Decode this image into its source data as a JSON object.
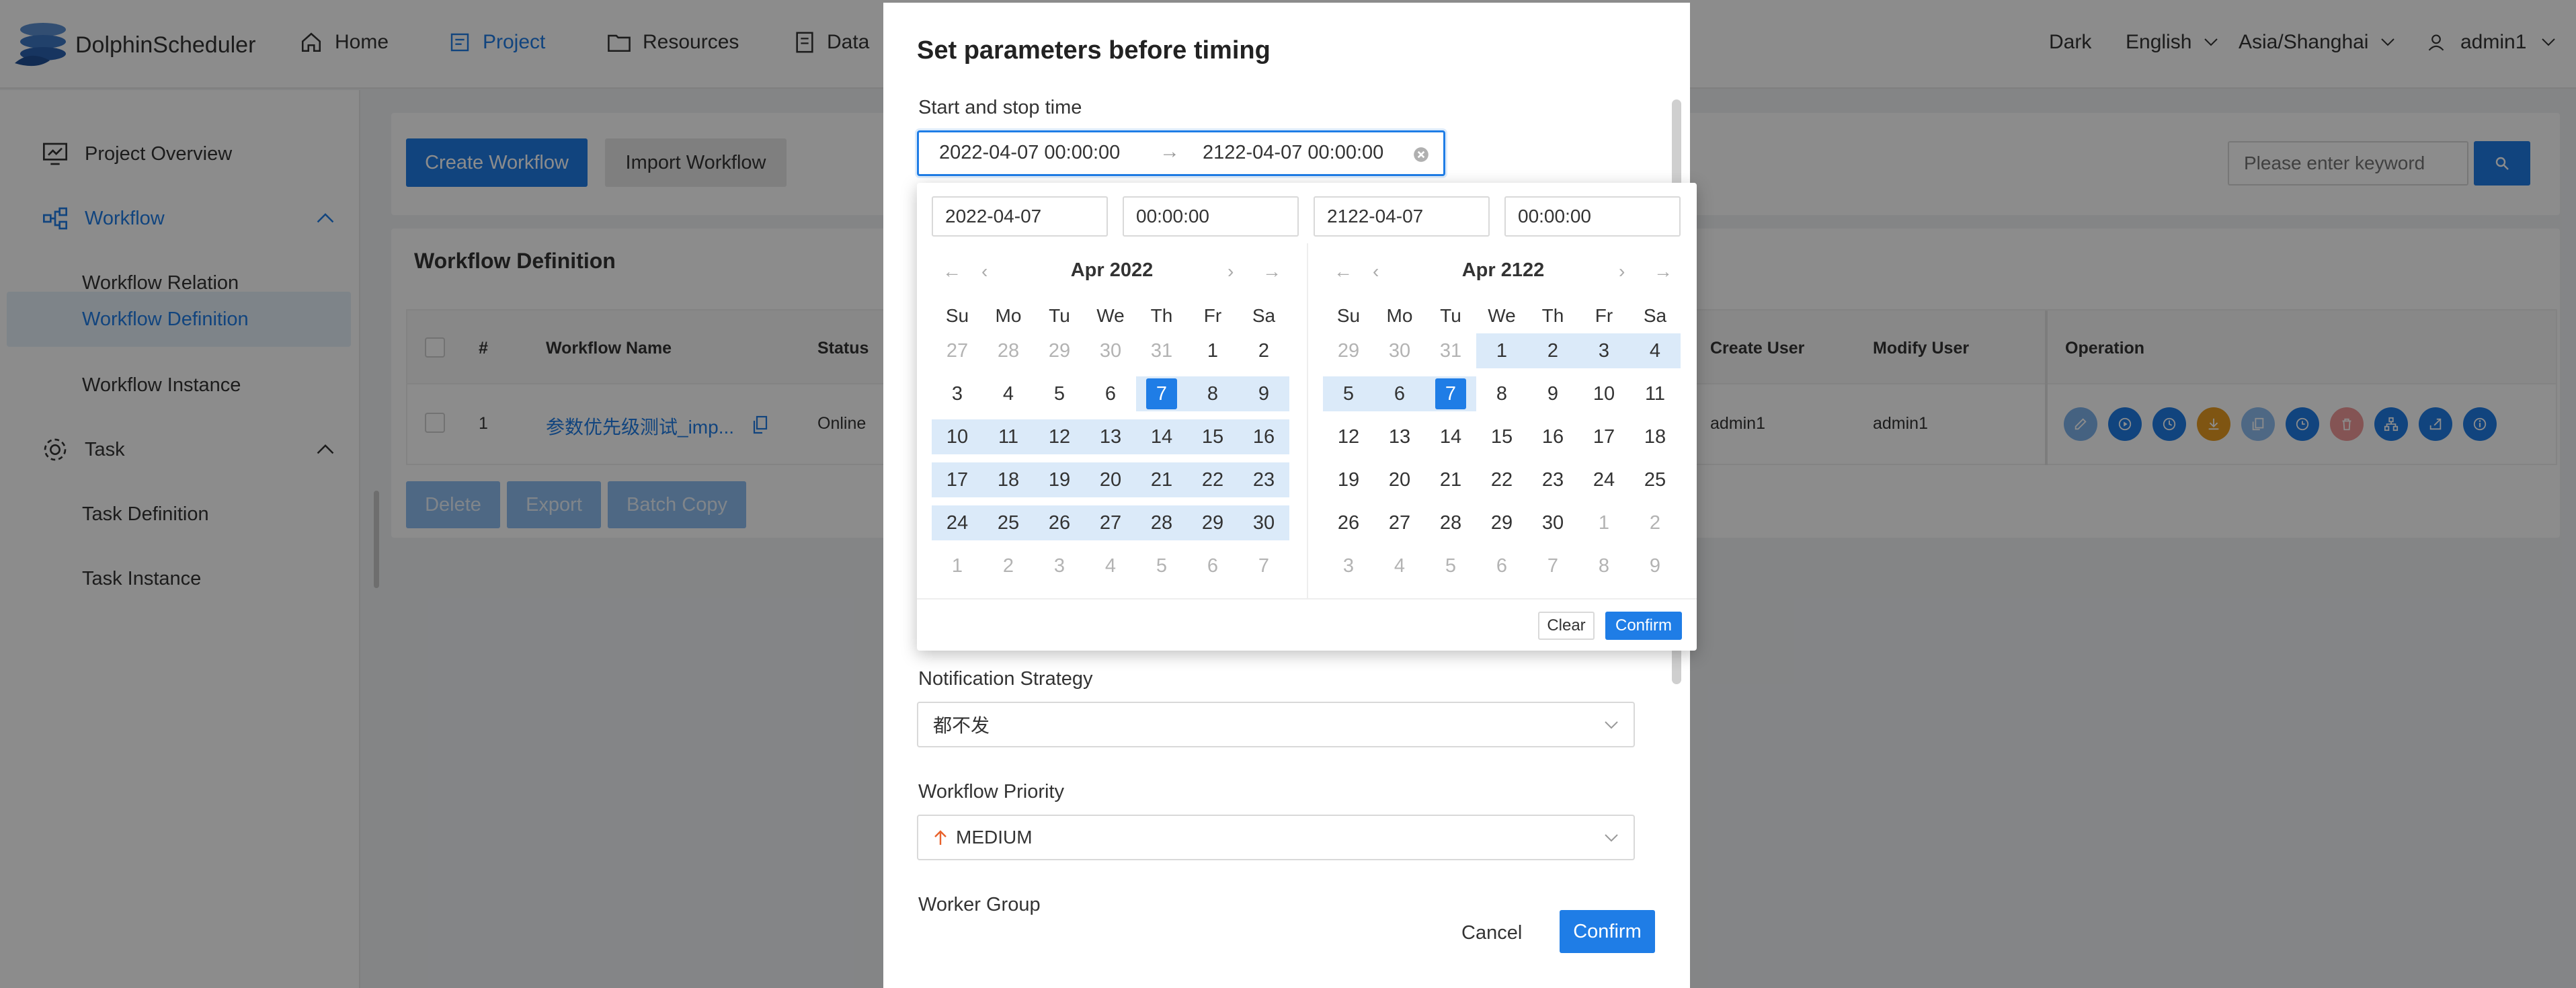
{
  "app": {
    "brand": "DolphinScheduler",
    "nav": [
      {
        "label": "Home",
        "icon": "home-icon"
      },
      {
        "label": "Project",
        "icon": "project-icon"
      },
      {
        "label": "Resources",
        "icon": "folder-icon"
      },
      {
        "label": "Data",
        "icon": "document-icon"
      }
    ],
    "theme": "Dark",
    "language": "English",
    "timezone": "Asia/Shanghai",
    "user": "admin1"
  },
  "sidebar": {
    "project_overview": "Project Overview",
    "workflow": "Workflow",
    "workflow_relation": "Workflow Relation",
    "workflow_definition": "Workflow Definition",
    "workflow_instance": "Workflow Instance",
    "task": "Task",
    "task_definition": "Task Definition",
    "task_instance": "Task Instance"
  },
  "toolbar": {
    "create_workflow": "Create Workflow",
    "import_workflow": "Import Workflow",
    "search_placeholder": "Please enter keyword"
  },
  "table": {
    "title": "Workflow Definition",
    "headers": {
      "index": "#",
      "name": "Workflow Name",
      "status": "Status",
      "create_user": "Create User",
      "modify_user": "Modify User",
      "operation": "Operation"
    },
    "rows": [
      {
        "index": "1",
        "name": "参数优先级测试_imp...",
        "status": "Online",
        "create_user": "admin1",
        "modify_user": "admin1"
      }
    ],
    "actions": {
      "delete": "Delete",
      "export": "Export",
      "batch_copy": "Batch Copy"
    }
  },
  "operation_icons": [
    {
      "name": "edit-icon",
      "color": "#7fb3ec"
    },
    {
      "name": "run-icon",
      "color": "#1f7de6"
    },
    {
      "name": "timing-icon",
      "color": "#1f7de6"
    },
    {
      "name": "download-icon",
      "color": "#e89c22"
    },
    {
      "name": "copy-icon",
      "color": "#8fbdf0"
    },
    {
      "name": "schedule-icon",
      "color": "#1f7de6"
    },
    {
      "name": "delete-icon",
      "color": "#f09a9a"
    },
    {
      "name": "tree-icon",
      "color": "#1f7de6"
    },
    {
      "name": "export-icon",
      "color": "#1f7de6"
    },
    {
      "name": "info-icon",
      "color": "#1f7de6"
    }
  ],
  "modal": {
    "title": "Set parameters before timing",
    "start_stop_label": "Start and stop time",
    "start_value": "2022-04-07 00:00:00",
    "range_arrow": "→",
    "end_value": "2122-04-07 00:00:00",
    "notification_label": "Notification Strategy",
    "notification_value": "都不发",
    "priority_label": "Workflow Priority",
    "priority_value": "MEDIUM",
    "worker_group_label": "Worker Group",
    "cancel": "Cancel",
    "confirm": "Confirm"
  },
  "picker": {
    "start_date": "2022-04-07",
    "start_time": "00:00:00",
    "end_date": "2122-04-07",
    "end_time": "00:00:00",
    "weekdays": [
      "Su",
      "Mo",
      "Tu",
      "We",
      "Th",
      "Fr",
      "Sa"
    ],
    "left": {
      "month": "Apr 2022",
      "days": [
        [
          "27",
          "28",
          "29",
          "30",
          "31",
          "1",
          "2"
        ],
        [
          "3",
          "4",
          "5",
          "6",
          "7",
          "8",
          "9"
        ],
        [
          "10",
          "11",
          "12",
          "13",
          "14",
          "15",
          "16"
        ],
        [
          "17",
          "18",
          "19",
          "20",
          "21",
          "22",
          "23"
        ],
        [
          "24",
          "25",
          "26",
          "27",
          "28",
          "29",
          "30"
        ],
        [
          "1",
          "2",
          "3",
          "4",
          "5",
          "6",
          "7"
        ]
      ]
    },
    "right": {
      "month": "Apr 2122",
      "days": [
        [
          "29",
          "30",
          "31",
          "1",
          "2",
          "3",
          "4"
        ],
        [
          "5",
          "6",
          "7",
          "8",
          "9",
          "10",
          "11"
        ],
        [
          "12",
          "13",
          "14",
          "15",
          "16",
          "17",
          "18"
        ],
        [
          "19",
          "20",
          "21",
          "22",
          "23",
          "24",
          "25"
        ],
        [
          "26",
          "27",
          "28",
          "29",
          "30",
          "1",
          "2"
        ],
        [
          "3",
          "4",
          "5",
          "6",
          "7",
          "8",
          "9"
        ]
      ]
    },
    "clear": "Clear",
    "confirm": "Confirm"
  },
  "colors": {
    "accent": "#1f7de6",
    "range": "#dbeaf9"
  }
}
